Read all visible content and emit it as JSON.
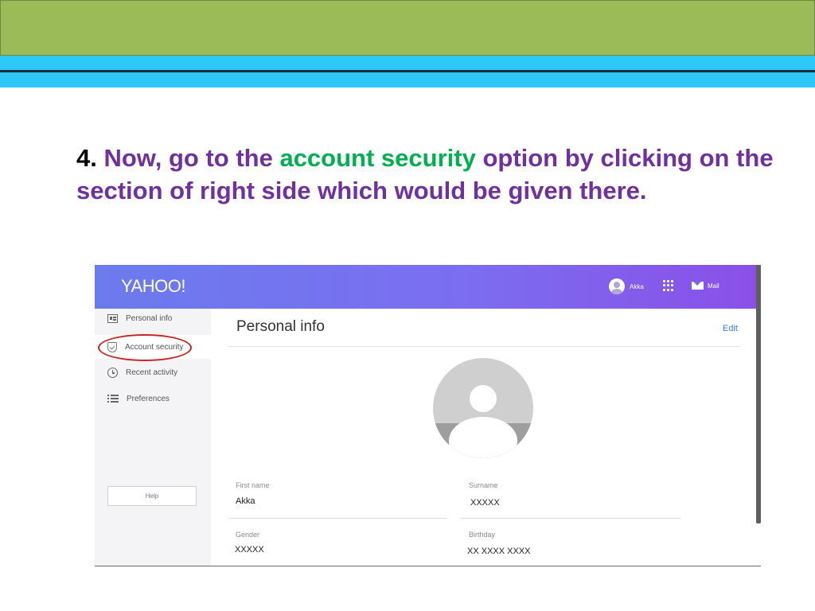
{
  "slide": {
    "step_number": "4.",
    "text_before": " Now, go to the ",
    "highlight": "account security",
    "text_after": " option by clicking on the section of right side which would be given there."
  },
  "colors": {
    "header_green": "#9bbb59",
    "header_blue": "#2ec8f8",
    "text_purple": "#7030a0",
    "text_green": "#00b050",
    "annotation_red": "#cc2222"
  },
  "screenshot": {
    "header": {
      "logo": "YAHOO!",
      "user_name": "Akka",
      "apps_icon": "grid-icon",
      "mail_label": "Mail"
    },
    "sidebar": {
      "items": [
        {
          "label": "Personal info",
          "icon": "person-card-icon"
        },
        {
          "label": "Account security",
          "icon": "shield-icon"
        },
        {
          "label": "Recent activity",
          "icon": "clock-icon"
        },
        {
          "label": "Preferences",
          "icon": "list-icon"
        }
      ],
      "help_label": "Help"
    },
    "main": {
      "title": "Personal info",
      "edit_label": "Edit",
      "fields": [
        {
          "label": "First name",
          "value": "Akka"
        },
        {
          "label": "Surname",
          "value": "XXXXX"
        },
        {
          "label": "Gender",
          "value": "XXXXX"
        },
        {
          "label": "Birthday",
          "value": "XX XXXX XXXX"
        }
      ]
    }
  }
}
